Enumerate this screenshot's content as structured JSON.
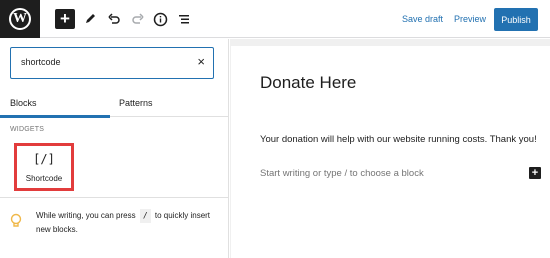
{
  "toolbar": {
    "logo_icon": "wordpress-logo-icon",
    "logo_letter": "W",
    "add_icon_glyph": "+",
    "save_draft_label": "Save draft",
    "preview_label": "Preview",
    "publish_label": "Publish",
    "accent_color": "#2271b1"
  },
  "inserter": {
    "search_value": "shortcode",
    "clear_glyph": "×",
    "tabs": [
      {
        "label": "Blocks",
        "active": true
      },
      {
        "label": "Patterns",
        "active": false
      }
    ],
    "category_label": "WIDGETS",
    "blocks": [
      {
        "icon": "[/]",
        "label": "Shortcode"
      }
    ],
    "tip": {
      "before": "While writing, you can press",
      "key": "/",
      "after": "to quickly insert new blocks."
    }
  },
  "editor": {
    "title": "Donate Here",
    "paragraph": "Your donation will help with our website running costs. Thank you!",
    "placeholder": "Start writing or type / to choose a block",
    "add_glyph": "+"
  }
}
